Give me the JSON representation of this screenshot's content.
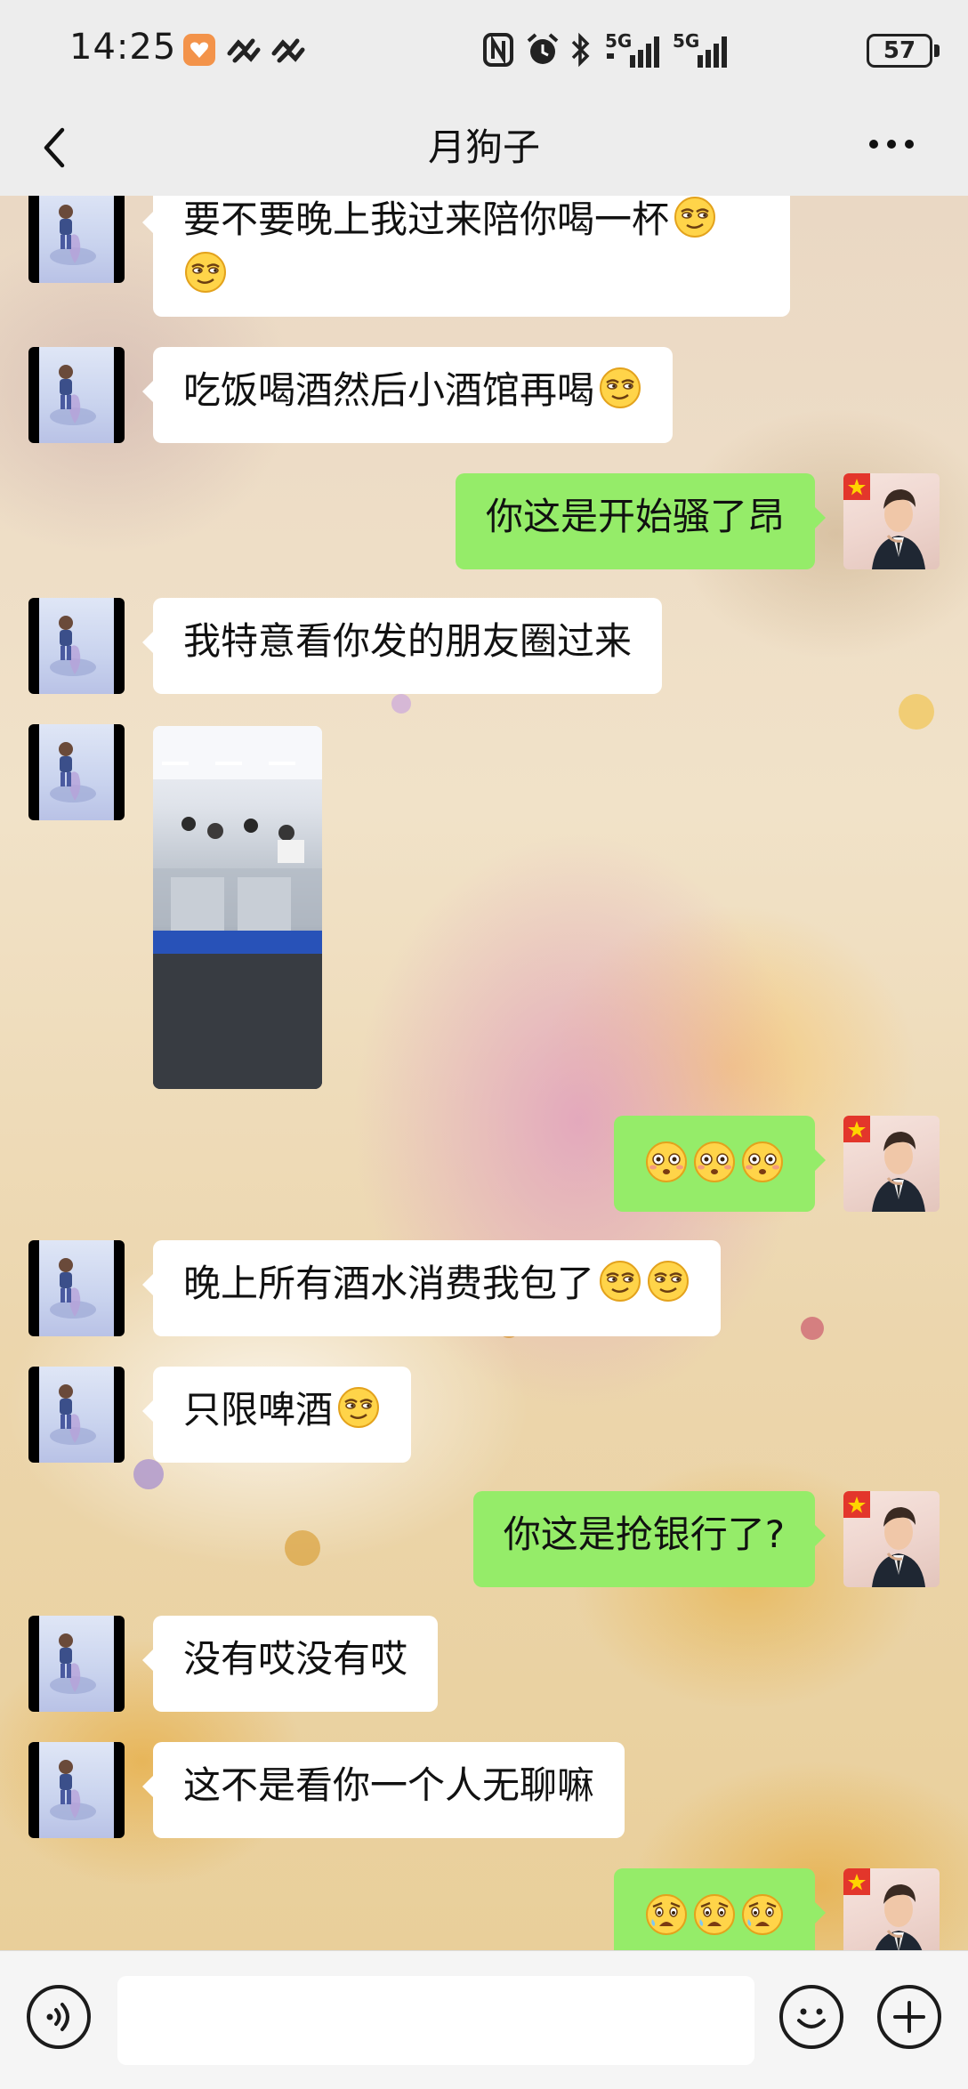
{
  "status_bar": {
    "time": "14:25",
    "network_1": "5G",
    "network_2": "5G",
    "battery": "57",
    "icons": [
      "app-heart-icon",
      "link-icon",
      "link-icon",
      "nfc-icon",
      "alarm-icon",
      "bluetooth-icon",
      "signal-icon",
      "signal-icon",
      "battery-icon"
    ]
  },
  "header": {
    "title": "月狗子",
    "back_icon": "chevron-left-icon",
    "more_icon": "more-dots-icon"
  },
  "messages": [
    {
      "side": "left",
      "type": "text",
      "text": "要不要晚上我过来陪你喝一杯",
      "emojis": [
        "smirk",
        "smirk"
      ]
    },
    {
      "side": "left",
      "type": "text",
      "text": "吃饭喝酒然后小酒馆再喝",
      "emojis": [
        "smirk"
      ]
    },
    {
      "side": "right",
      "type": "text",
      "text": "你这是开始骚了昂",
      "emojis": []
    },
    {
      "side": "left",
      "type": "text",
      "text": "我特意看你发的朋友圈过来",
      "emojis": []
    },
    {
      "side": "left",
      "type": "image",
      "text": "",
      "emojis": []
    },
    {
      "side": "right",
      "type": "text",
      "text": "",
      "emojis": [
        "flushed",
        "flushed",
        "flushed"
      ]
    },
    {
      "side": "left",
      "type": "text",
      "text": "晚上所有酒水消费我包了",
      "emojis": [
        "smirk",
        "smirk"
      ]
    },
    {
      "side": "left",
      "type": "text",
      "text": "只限啤酒",
      "emojis": [
        "smirk"
      ]
    },
    {
      "side": "right",
      "type": "text",
      "text": "你这是抢银行了?",
      "emojis": []
    },
    {
      "side": "left",
      "type": "text",
      "text": "没有哎没有哎",
      "emojis": []
    },
    {
      "side": "left",
      "type": "text",
      "text": "这不是看你一个人无聊嘛",
      "emojis": []
    },
    {
      "side": "right",
      "type": "text",
      "text": "",
      "emojis": [
        "fearful",
        "fearful",
        "fearful"
      ]
    }
  ],
  "input_bar": {
    "voice_icon": "voice-icon",
    "message_value": "",
    "emoji_icon": "emoji-icon",
    "plus_icon": "plus-icon"
  },
  "colors": {
    "header_bg": "#ededed",
    "bubble_self": "#95ec69",
    "bubble_other": "#ffffff"
  }
}
